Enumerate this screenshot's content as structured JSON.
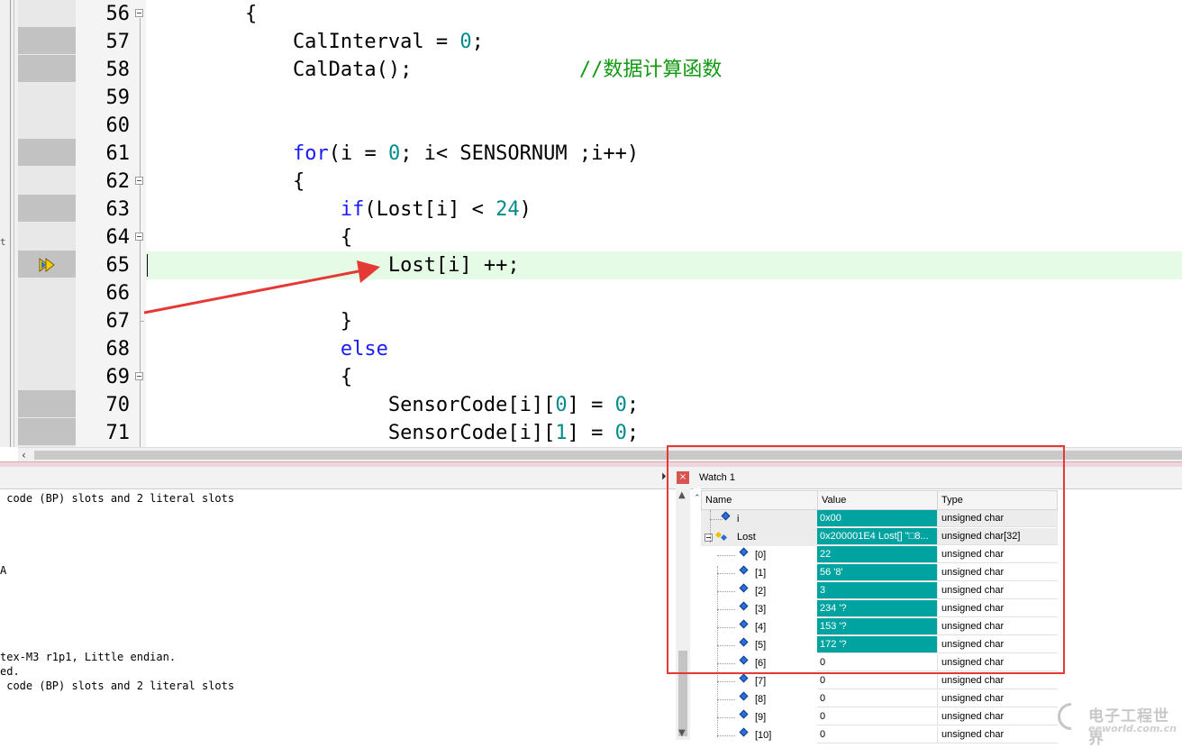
{
  "editor": {
    "lines": [
      {
        "n": "56",
        "code": [
          {
            "t": "        {",
            "c": ""
          }
        ]
      },
      {
        "n": "57",
        "code": [
          {
            "t": "            CalInterval = ",
            "c": ""
          },
          {
            "t": "0",
            "c": "num"
          },
          {
            "t": ";",
            "c": ""
          }
        ]
      },
      {
        "n": "58",
        "code": [
          {
            "t": "            CalData();              ",
            "c": ""
          },
          {
            "t": "//数据计算函数",
            "c": "cm"
          }
        ]
      },
      {
        "n": "59",
        "code": []
      },
      {
        "n": "60",
        "code": []
      },
      {
        "n": "61",
        "code": [
          {
            "t": "            ",
            "c": ""
          },
          {
            "t": "for",
            "c": "kw"
          },
          {
            "t": "(i = ",
            "c": ""
          },
          {
            "t": "0",
            "c": "num"
          },
          {
            "t": "; i< SENSORNUM ;i++)",
            "c": ""
          }
        ]
      },
      {
        "n": "62",
        "code": [
          {
            "t": "            {",
            "c": ""
          }
        ]
      },
      {
        "n": "63",
        "code": [
          {
            "t": "                ",
            "c": ""
          },
          {
            "t": "if",
            "c": "kw"
          },
          {
            "t": "(Lost[i] < ",
            "c": ""
          },
          {
            "t": "24",
            "c": "num"
          },
          {
            "t": ")",
            "c": ""
          }
        ]
      },
      {
        "n": "64",
        "code": [
          {
            "t": "                {",
            "c": ""
          }
        ]
      },
      {
        "n": "65",
        "code": [
          {
            "t": "                    Lost[i] ++;",
            "c": ""
          }
        ]
      },
      {
        "n": "66",
        "code": []
      },
      {
        "n": "67",
        "code": [
          {
            "t": "                }",
            "c": ""
          }
        ]
      },
      {
        "n": "68",
        "code": [
          {
            "t": "                ",
            "c": ""
          },
          {
            "t": "else",
            "c": "kw"
          }
        ]
      },
      {
        "n": "69",
        "code": [
          {
            "t": "                {",
            "c": ""
          }
        ]
      },
      {
        "n": "70",
        "code": [
          {
            "t": "                    SensorCode[i][",
            "c": ""
          },
          {
            "t": "0",
            "c": "num"
          },
          {
            "t": "] = ",
            "c": ""
          },
          {
            "t": "0",
            "c": "num"
          },
          {
            "t": ";",
            "c": ""
          }
        ]
      },
      {
        "n": "71",
        "code": [
          {
            "t": "                    SensorCode[i][",
            "c": ""
          },
          {
            "t": "1",
            "c": "num"
          },
          {
            "t": "] = ",
            "c": ""
          },
          {
            "t": "0",
            "c": "num"
          },
          {
            "t": ";",
            "c": ""
          }
        ]
      }
    ],
    "current_line": "65",
    "left_strip_mark": "t"
  },
  "output": {
    "lines": [
      " code (BP) slots and 2 literal slots",
      "",
      "",
      "",
      "",
      "A",
      "",
      "",
      "",
      "",
      "",
      "tex-M3 r1p1, Little endian.",
      "ed.",
      " code (BP) slots and 2 literal slots"
    ],
    "pin_icon": "pin-icon",
    "close_label": "×"
  },
  "watch": {
    "title": "Watch 1",
    "columns": {
      "name": "Name",
      "value": "Value",
      "type": "Type"
    },
    "rows": [
      {
        "name": "i",
        "value": "0x00",
        "type": "unsigned char",
        "changed": true
      },
      {
        "name": "Lost",
        "value": "0x200001E4 Lost[] \"□8...",
        "type": "unsigned char[32]",
        "changed": true
      },
      {
        "name": "[0]",
        "value": "22",
        "type": "unsigned char",
        "changed": true
      },
      {
        "name": "[1]",
        "value": "56 '8'",
        "type": "unsigned char",
        "changed": true
      },
      {
        "name": "[2]",
        "value": "3",
        "type": "unsigned char",
        "changed": true
      },
      {
        "name": "[3]",
        "value": "234 '?",
        "type": "unsigned char",
        "changed": true
      },
      {
        "name": "[4]",
        "value": "153 '?",
        "type": "unsigned char",
        "changed": true
      },
      {
        "name": "[5]",
        "value": "172 '?",
        "type": "unsigned char",
        "changed": true
      },
      {
        "name": "[6]",
        "value": "0",
        "type": "unsigned char",
        "changed": false
      },
      {
        "name": "[7]",
        "value": "0",
        "type": "unsigned char",
        "changed": false
      },
      {
        "name": "[8]",
        "value": "0",
        "type": "unsigned char",
        "changed": false
      },
      {
        "name": "[9]",
        "value": "0",
        "type": "unsigned char",
        "changed": false
      },
      {
        "name": "[10]",
        "value": "0",
        "type": "unsigned char",
        "changed": false
      }
    ]
  },
  "watermark": {
    "text": "电子工程世界",
    "sub": "eeworld.com.cn"
  },
  "colors": {
    "changed_value": "#00a3a0",
    "annotation": "#e53935",
    "current_line": "#e5fbe5",
    "keyword": "#1a1aff",
    "number": "#008b8b",
    "comment": "#119911"
  }
}
